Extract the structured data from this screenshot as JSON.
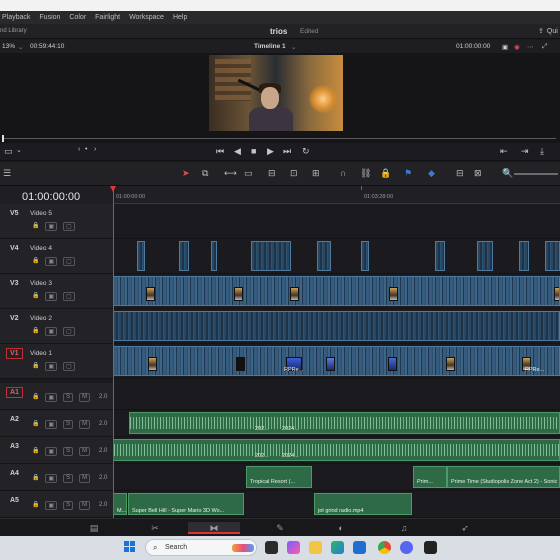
{
  "menu": [
    "Playback",
    "Fusion",
    "Color",
    "Fairlight",
    "Workspace",
    "Help"
  ],
  "title": {
    "library": "nd Library",
    "project": "trios",
    "status": "Edited",
    "quick": "Qui"
  },
  "viewer_bar": {
    "zoom": "13%",
    "source_tc": "00:59:44:10",
    "timeline_name": "Timeline 1",
    "record_tc": "01:00:00:00"
  },
  "timeline": {
    "timecode": "01:00:00:00",
    "ruler": [
      "01:00:00:00",
      "01:03:28:00"
    ]
  },
  "tracks": {
    "video": [
      {
        "id": "V5",
        "name": "Video 5"
      },
      {
        "id": "V4",
        "name": "Video 4"
      },
      {
        "id": "V3",
        "name": "Video 3"
      },
      {
        "id": "V2",
        "name": "Video 2"
      },
      {
        "id": "V1",
        "name": "Video 1"
      }
    ],
    "audio": [
      {
        "id": "A1",
        "vol": "2.0",
        "solo": "S",
        "mute": "M"
      },
      {
        "id": "A2",
        "vol": "2.0",
        "solo": "S",
        "mute": "M"
      },
      {
        "id": "A3",
        "vol": "2.0",
        "solo": "S",
        "mute": "M"
      },
      {
        "id": "A4",
        "vol": "2.0",
        "solo": "S",
        "mute": "M"
      },
      {
        "id": "A5",
        "vol": "2.0",
        "solo": "S",
        "mute": "M"
      }
    ]
  },
  "clips": {
    "v1_label_a": "RPRe...",
    "v1_label_b": "RPRe...",
    "a2_label_a": "202...",
    "a2_label_b": "2024...",
    "a3_label_a": "202...",
    "a3_label_b": "2024...",
    "a4_label_a": "Tropical Resort (...",
    "a4_label_b": "Prim...",
    "a4_label_c": "Prime Time (Studiopolis Zone Act 2) - Sonic",
    "a5_label_a": "M...",
    "a5_label_b": "Super Bell Hill - Super Mario 3D Wo...",
    "a5_label_c": "jet grind radio.mp4"
  },
  "taskbar": {
    "search_placeholder": "Search"
  },
  "colors": {
    "video_clip": "#365b7d",
    "audio_clip": "#2e6a45",
    "playhead": "#e0383a",
    "accent": "#d33333"
  }
}
